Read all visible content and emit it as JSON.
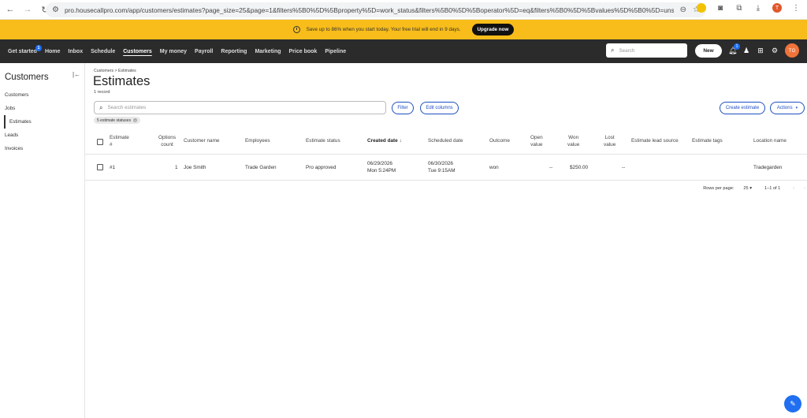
{
  "browser": {
    "url": "pro.housecallpro.com/app/customers/estimates?page_size=25&page=1&filters%5B0%5D%5Bproperty%5D=work_status&filters%5B0%5D%5Boperator%5D=eq&filters%5B0%5D%5Bvalues%5D%5B0%5D=unscheduled&filters%5B0...",
    "profile_initial": "T"
  },
  "banner": {
    "text": "Save up to 86% when you start today. Your free trial will end in 9 days.",
    "upgrade_label": "Upgrade now"
  },
  "nav": {
    "items": [
      {
        "label": "Get started",
        "badge": "1"
      },
      {
        "label": "Home"
      },
      {
        "label": "Inbox"
      },
      {
        "label": "Schedule"
      },
      {
        "label": "Customers"
      },
      {
        "label": "My money"
      },
      {
        "label": "Payroll"
      },
      {
        "label": "Reporting"
      },
      {
        "label": "Marketing"
      },
      {
        "label": "Price book"
      },
      {
        "label": "Pipeline"
      }
    ],
    "search_placeholder": "Search",
    "new_label": "New",
    "notification_count": "1",
    "avatar_initials": "TG"
  },
  "sidebar": {
    "title": "Customers",
    "items": [
      "Customers",
      "Jobs",
      "Estimates",
      "Leads",
      "Invoices"
    ]
  },
  "page": {
    "breadcrumb": "Customers > Estimates",
    "title": "Estimates",
    "record_count": "1 record",
    "search_placeholder": "Search estimates",
    "filter_label": "Filter",
    "edit_columns_label": "Edit columns",
    "create_label": "Create estimate",
    "actions_label": "Actions",
    "chip_label": "5 estimate statuses"
  },
  "table": {
    "headers": {
      "estimate": [
        "Estimate",
        "#"
      ],
      "options": [
        "Options",
        "count"
      ],
      "customer": "Customer name",
      "employees": "Employees",
      "status": "Estimate status",
      "created": "Created date",
      "scheduled": "Scheduled date",
      "outcome": "Outcome",
      "open_value": [
        "Open",
        "value"
      ],
      "won_value": [
        "Won",
        "value"
      ],
      "lost_value": [
        "Lost",
        "value"
      ],
      "lead_source": "Estimate lead source",
      "tags": "Estimate tags",
      "location": "Location name"
    },
    "rows": [
      {
        "estimate": "#1",
        "options": "1",
        "customer": "Joe Smith",
        "employees": "Trade Garden",
        "status": "Pro approved",
        "created_date": "06/29/2026",
        "created_time": "Mon 5:24PM",
        "scheduled_date": "06/30/2026",
        "scheduled_time": "Tue 9:15AM",
        "outcome": "won",
        "open_value": "--",
        "won_value": "$250.00",
        "lost_value": "--",
        "location": "Tradegarden"
      }
    ]
  },
  "pager": {
    "rows_label": "Rows per page:",
    "rows_value": "25",
    "range": "1–1 of 1"
  }
}
